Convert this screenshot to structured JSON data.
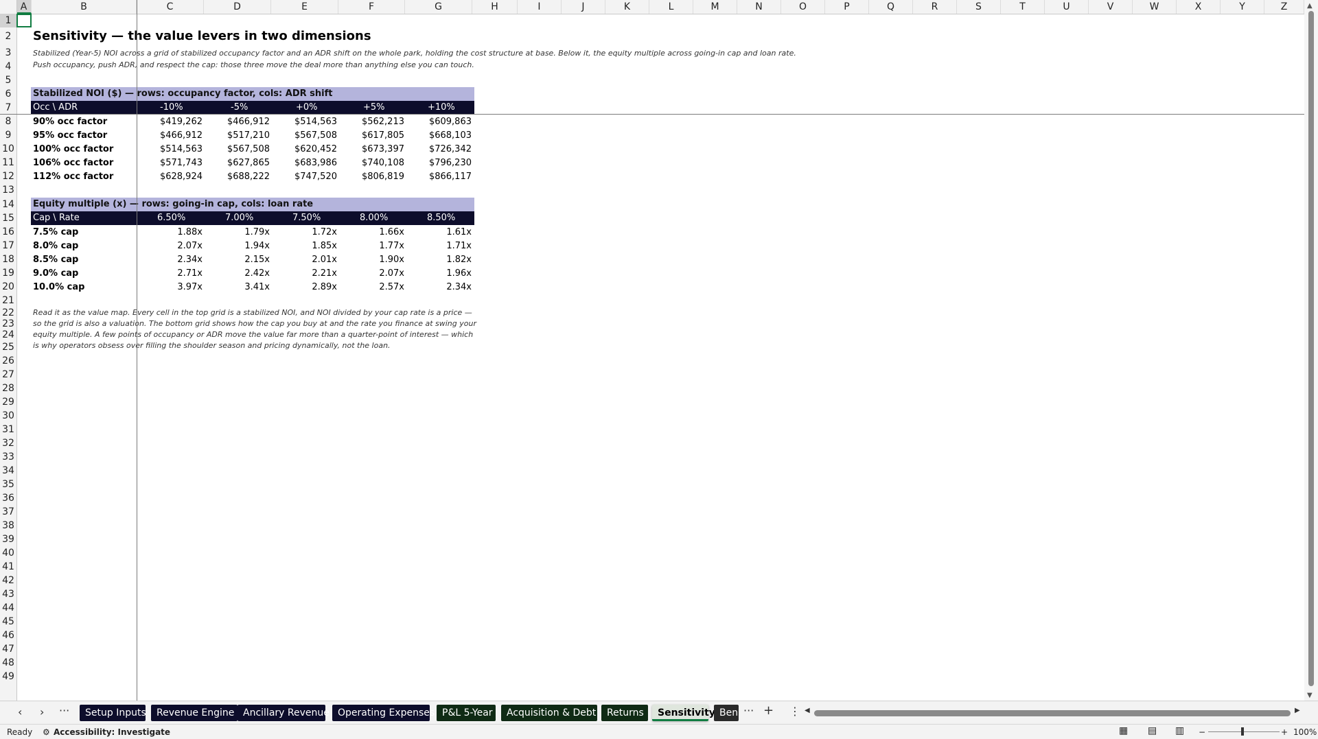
{
  "columns": [
    "A",
    "B",
    "C",
    "D",
    "E",
    "F",
    "G",
    "H",
    "I",
    "J",
    "K",
    "L",
    "M",
    "N",
    "O",
    "P",
    "Q",
    "R",
    "S",
    "T",
    "U",
    "V",
    "W",
    "X",
    "Y",
    "Z"
  ],
  "rows": [
    "1",
    "2",
    "3",
    "4",
    "5",
    "6",
    "7",
    "8",
    "9",
    "10",
    "11",
    "12",
    "13",
    "14",
    "15",
    "16",
    "17",
    "18",
    "19",
    "20",
    "21",
    "22",
    "23",
    "24",
    "25",
    "26",
    "27",
    "28",
    "29",
    "30",
    "31",
    "32",
    "33",
    "34",
    "35",
    "36",
    "37",
    "38",
    "39",
    "40",
    "41",
    "42",
    "43",
    "44",
    "45",
    "46",
    "47",
    "48",
    "49"
  ],
  "sheet": {
    "title": "Sensitivity — the value levers in two dimensions",
    "subtitle1": "Stabilized (Year-5) NOI across a grid of stabilized occupancy factor and an ADR shift on the whole park, holding the cost structure at base. Below it, the equity multiple across going-in cap and loan rate.",
    "subtitle2": "Push occupancy, push ADR, and respect the cap: those three move the deal more than anything else you can touch.",
    "noi": {
      "header": "Stabilized NOI ($) — rows: occupancy factor, cols: ADR shift",
      "corner": "Occ \\ ADR",
      "cols": [
        "-10%",
        "-5%",
        "+0%",
        "+5%",
        "+10%"
      ],
      "rows": [
        {
          "label": "90% occ factor",
          "values": [
            "$419,262",
            "$466,912",
            "$514,563",
            "$562,213",
            "$609,863"
          ]
        },
        {
          "label": "95% occ factor",
          "values": [
            "$466,912",
            "$517,210",
            "$567,508",
            "$617,805",
            "$668,103"
          ]
        },
        {
          "label": "100% occ factor",
          "values": [
            "$514,563",
            "$567,508",
            "$620,452",
            "$673,397",
            "$726,342"
          ]
        },
        {
          "label": "106% occ factor",
          "values": [
            "$571,743",
            "$627,865",
            "$683,986",
            "$740,108",
            "$796,230"
          ]
        },
        {
          "label": "112% occ factor",
          "values": [
            "$628,924",
            "$688,222",
            "$747,520",
            "$806,819",
            "$866,117"
          ]
        }
      ]
    },
    "equity": {
      "header": "Equity multiple (x) — rows: going-in cap, cols: loan rate",
      "corner": "Cap \\ Rate",
      "cols": [
        "6.50%",
        "7.00%",
        "7.50%",
        "8.00%",
        "8.50%"
      ],
      "rows": [
        {
          "label": "7.5% cap",
          "values": [
            "1.88x",
            "1.79x",
            "1.72x",
            "1.66x",
            "1.61x"
          ]
        },
        {
          "label": "8.0% cap",
          "values": [
            "2.07x",
            "1.94x",
            "1.85x",
            "1.77x",
            "1.71x"
          ]
        },
        {
          "label": "8.5% cap",
          "values": [
            "2.34x",
            "2.15x",
            "2.01x",
            "1.90x",
            "1.82x"
          ]
        },
        {
          "label": "9.0% cap",
          "values": [
            "2.71x",
            "2.42x",
            "2.21x",
            "2.07x",
            "1.96x"
          ]
        },
        {
          "label": "10.0% cap",
          "values": [
            "3.97x",
            "3.41x",
            "2.89x",
            "2.57x",
            "2.34x"
          ]
        }
      ]
    },
    "note": "Read it as the value map. Every cell in the top grid is a stabilized NOI, and NOI divided by your cap rate is a price — so the grid is also a valuation. The bottom grid shows how the cap you buy at and the rate you finance at swing your equity multiple. A few points of occupancy or ADR move the value far more than a quarter-point of interest — which is why operators obsess over filling the shoulder season and pricing dynamically, not the loan."
  },
  "tabs": [
    {
      "label": "Setup Inputs",
      "color": "#0d0d2b"
    },
    {
      "label": "Revenue Engine",
      "color": "#0d0d2b"
    },
    {
      "label": "Ancillary Revenue",
      "color": "#0d0d2b"
    },
    {
      "label": "Operating Expenses",
      "color": "#0d0d2b"
    },
    {
      "label": "P&L 5-Year",
      "color": "#0f2a14"
    },
    {
      "label": "Acquisition & Debt",
      "color": "#0f2a14"
    },
    {
      "label": "Returns",
      "color": "#0f2a14"
    },
    {
      "label": "Sensitivity",
      "color": "#dfe6dd"
    },
    {
      "label": "Ben",
      "color": "#2a2a2a"
    }
  ],
  "status": {
    "ready": "Ready",
    "accessibility": "Accessibility: Investigate",
    "zoom": "100%"
  }
}
